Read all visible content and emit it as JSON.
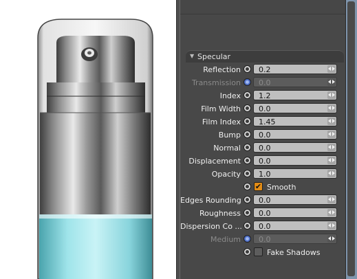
{
  "viewport": {
    "description_icon": "pump-bottle-render"
  },
  "section": {
    "title": "Specular"
  },
  "properties": [
    {
      "label": "Reflection",
      "value": "0.2",
      "enabled": true
    },
    {
      "label": "Transmission",
      "value": "0.0",
      "enabled": false
    },
    {
      "label": "Index",
      "value": "1.2",
      "enabled": true
    },
    {
      "label": "Film Width",
      "value": "0.0",
      "enabled": true
    },
    {
      "label": "Film Index",
      "value": "1.45",
      "enabled": true
    },
    {
      "label": "Bump",
      "value": "0.0",
      "enabled": true
    },
    {
      "label": "Normal",
      "value": "0.0",
      "enabled": true
    },
    {
      "label": "Displacement",
      "value": "0.0",
      "enabled": true
    },
    {
      "label": "Opacity",
      "value": "1.0",
      "enabled": true
    }
  ],
  "smooth": {
    "label": "Smooth",
    "checked": true
  },
  "properties2": [
    {
      "label": "Edges Rounding",
      "value": "0.0",
      "enabled": true
    },
    {
      "label": "Roughness",
      "value": "0.0",
      "enabled": true
    },
    {
      "label": "Dispersion Co ...",
      "value": "0.0",
      "enabled": true
    },
    {
      "label": "Medium",
      "value": "0.0",
      "enabled": false
    }
  ],
  "fake_shadows": {
    "label": "Fake Shadows",
    "checked": false
  },
  "colors": {
    "accent": "#e28c16",
    "panel_bg": "#484848",
    "field_bg": "#bfbfbf",
    "scrollbar": "#7f95ad"
  }
}
